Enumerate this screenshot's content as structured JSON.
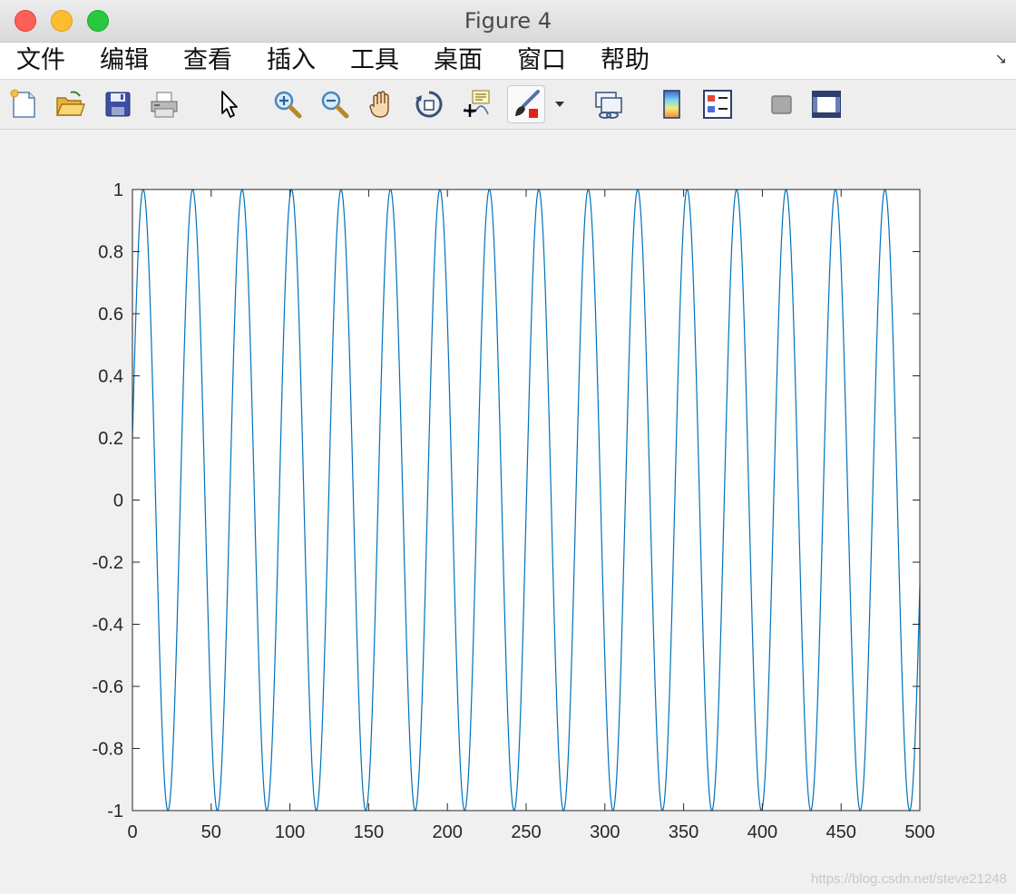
{
  "window": {
    "title": "Figure 4"
  },
  "menu": {
    "items": [
      "文件",
      "编辑",
      "查看",
      "插入",
      "工具",
      "桌面",
      "窗口",
      "帮助"
    ],
    "corner_glyph": "↘"
  },
  "toolbar": {
    "buttons": [
      {
        "icon": "new-figure-icon"
      },
      {
        "icon": "open-file-icon"
      },
      {
        "icon": "save-icon"
      },
      {
        "icon": "print-icon"
      },
      {
        "icon": "edit-plot-pointer-icon"
      },
      {
        "icon": "zoom-in-icon"
      },
      {
        "icon": "zoom-out-icon"
      },
      {
        "icon": "pan-hand-icon"
      },
      {
        "icon": "rotate-3d-icon"
      },
      {
        "icon": "data-cursor-icon"
      },
      {
        "icon": "brush-icon"
      },
      {
        "icon": "link-plot-icon"
      },
      {
        "icon": "colorbar-icon"
      },
      {
        "icon": "legend-icon"
      },
      {
        "icon": "hide-plot-tools-icon"
      },
      {
        "icon": "show-plot-tools-icon"
      }
    ]
  },
  "chart_data": {
    "type": "line",
    "title": "",
    "xlabel": "",
    "ylabel": "",
    "xlim": [
      0,
      500
    ],
    "ylim": [
      -1,
      1
    ],
    "xticks": [
      "0",
      "50",
      "100",
      "150",
      "200",
      "250",
      "300",
      "350",
      "400",
      "450",
      "500"
    ],
    "yticks": [
      "1",
      "0.8",
      "0.6",
      "0.4",
      "0.2",
      "0",
      "-0.2",
      "-0.4",
      "-0.6",
      "-0.8",
      "-1"
    ],
    "series": [
      {
        "color": "#0072bd",
        "function": "sin",
        "period": 31.4,
        "amplitude": 1,
        "y_at_x0": 0.2,
        "x_range": [
          0,
          500
        ]
      }
    ],
    "grid": false,
    "legend": "none"
  },
  "watermark": "https://blog.csdn.net/steve21248"
}
